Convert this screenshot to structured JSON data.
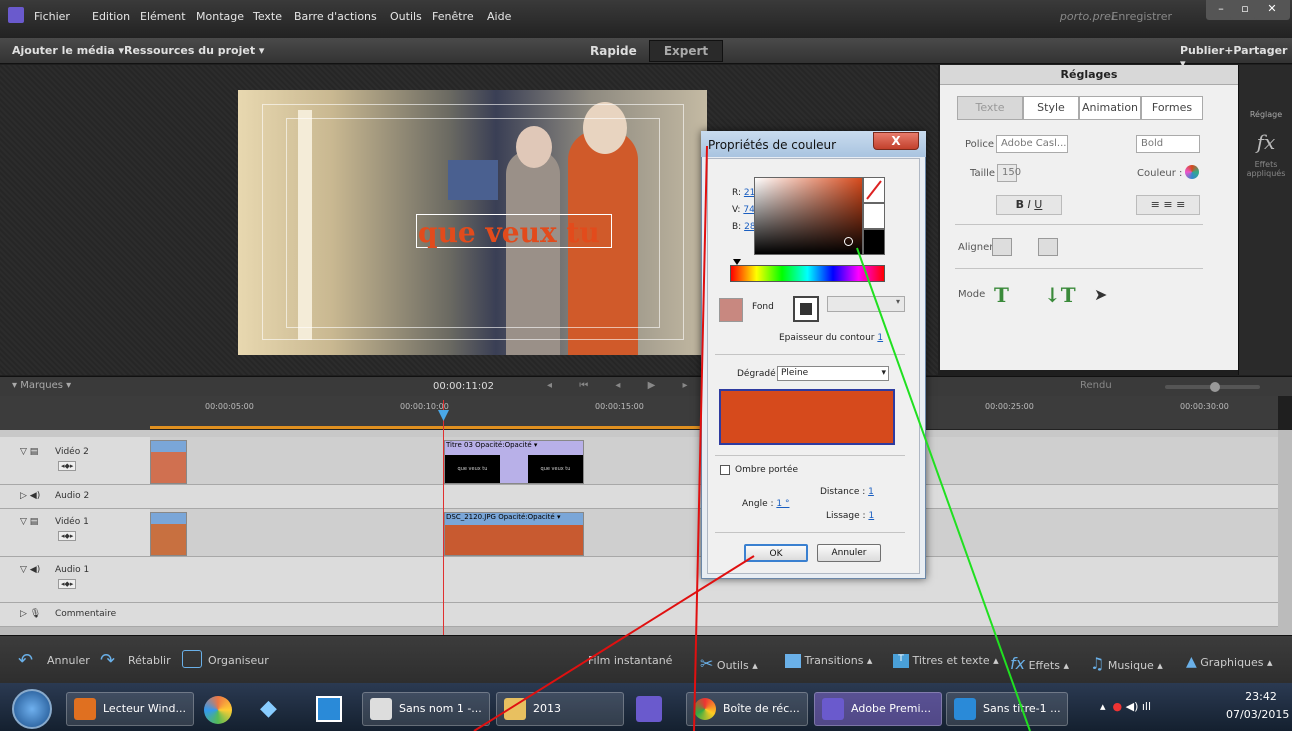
{
  "menu": [
    "Fichier",
    "Edition",
    "Elément",
    "Montage",
    "Texte",
    "Barre d'actions",
    "Outils",
    "Fenêtre",
    "Aide"
  ],
  "project_name": "porto.prel",
  "save_label": "Enregistrer",
  "toolbar": {
    "add_media": "Ajouter le média ▾",
    "project_assets": "Ressources du projet ▾",
    "mode_quick": "Rapide",
    "mode_expert": "Expert",
    "publish": "Publier+Partager ▾"
  },
  "preview": {
    "title_text": "que veux tu"
  },
  "settings": {
    "header": "Réglages",
    "tabs": [
      "Texte",
      "Style",
      "Animation",
      "Formes"
    ],
    "font_label": "Police",
    "font_value": "Adobe Casl...",
    "weight_value": "Bold",
    "size_label": "Taille",
    "size_value": "150",
    "color_label": "Couleur :",
    "align_label": "Aligner",
    "mode_label": "Mode"
  },
  "sidecol": {
    "adjust": "Réglage",
    "effects": "Effets appliqués"
  },
  "timeline": {
    "markers": "Marques",
    "timecode": "00:00:11:02",
    "render": "Rendu",
    "ticks": [
      "00:00:05:00",
      "00:00:10:00",
      "00:00:15:00",
      "00:00:25:00",
      "00:00:30:00"
    ],
    "tracks": [
      {
        "name": "Vidéo 2"
      },
      {
        "name": "Audio 2"
      },
      {
        "name": "Vidéo 1"
      },
      {
        "name": "Audio 1"
      },
      {
        "name": "Commentaire"
      }
    ],
    "clip_title": "Titre 03  Opacité:Opacité ▾",
    "clip_photo": "DSC_2120.JPG  Opacité:Opacité ▾",
    "clip_thumb_text": "que veux tu"
  },
  "bottom": {
    "undo": "Annuler",
    "redo": "Rétablir",
    "organizer": "Organiseur",
    "instant_movie": "Film instantané",
    "tools": "Outils ▴",
    "transitions": "Transitions ▴",
    "titles": "Titres et texte ▴",
    "effects": "Effets ▴",
    "music": "Musique ▴",
    "graphics": "Graphiques ▴"
  },
  "dialog": {
    "title": "Propriétés de couleur",
    "close": "X",
    "r_label": "R:",
    "r_value": "214",
    "g_label": "V:",
    "g_value": "74",
    "b_label": "B:",
    "b_value": "28",
    "fill_label": "Fond",
    "stroke_width_label": "Epaisseur du contour",
    "stroke_width_value": "1",
    "gradient_label": "Dégradé",
    "gradient_value": "Pleine",
    "shadow_label": "Ombre portée",
    "distance_label": "Distance :",
    "distance_value": "1",
    "angle_label": "Angle :",
    "angle_value": "1 °",
    "smooth_label": "Lissage :",
    "smooth_value": "1",
    "ok": "OK",
    "cancel": "Annuler",
    "color": "#d64a1c"
  },
  "taskbar": {
    "items": [
      "Lecteur Wind...",
      "Sans nom 1 -...",
      "2013",
      "Boîte de réc...",
      "Adobe Premi...",
      "Sans titre-1 ..."
    ],
    "time": "23:42",
    "date": "07/03/2015"
  }
}
